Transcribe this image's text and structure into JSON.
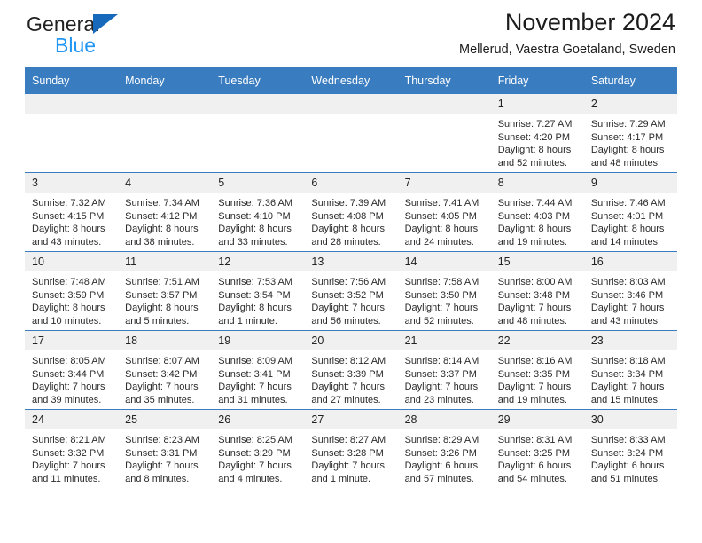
{
  "brand": {
    "name_top": "General",
    "name_bottom": "Blue",
    "accent_color": "#1669bb",
    "blue_color": "#2196f3",
    "triangle_icon": "brand-triangle-icon"
  },
  "header": {
    "title": "November 2024",
    "subtitle": "Mellerud, Vaestra Goetaland, Sweden"
  },
  "calendar": {
    "header_bg": "#3a7cc0",
    "daynum_bg": "#f0f0f0",
    "weekday_labels": [
      "Sunday",
      "Monday",
      "Tuesday",
      "Wednesday",
      "Thursday",
      "Friday",
      "Saturday"
    ],
    "weeks": [
      [
        {
          "day": "",
          "lines": []
        },
        {
          "day": "",
          "lines": []
        },
        {
          "day": "",
          "lines": []
        },
        {
          "day": "",
          "lines": []
        },
        {
          "day": "",
          "lines": []
        },
        {
          "day": "1",
          "lines": [
            "Sunrise: 7:27 AM",
            "Sunset: 4:20 PM",
            "Daylight: 8 hours",
            "and 52 minutes."
          ]
        },
        {
          "day": "2",
          "lines": [
            "Sunrise: 7:29 AM",
            "Sunset: 4:17 PM",
            "Daylight: 8 hours",
            "and 48 minutes."
          ]
        }
      ],
      [
        {
          "day": "3",
          "lines": [
            "Sunrise: 7:32 AM",
            "Sunset: 4:15 PM",
            "Daylight: 8 hours",
            "and 43 minutes."
          ]
        },
        {
          "day": "4",
          "lines": [
            "Sunrise: 7:34 AM",
            "Sunset: 4:12 PM",
            "Daylight: 8 hours",
            "and 38 minutes."
          ]
        },
        {
          "day": "5",
          "lines": [
            "Sunrise: 7:36 AM",
            "Sunset: 4:10 PM",
            "Daylight: 8 hours",
            "and 33 minutes."
          ]
        },
        {
          "day": "6",
          "lines": [
            "Sunrise: 7:39 AM",
            "Sunset: 4:08 PM",
            "Daylight: 8 hours",
            "and 28 minutes."
          ]
        },
        {
          "day": "7",
          "lines": [
            "Sunrise: 7:41 AM",
            "Sunset: 4:05 PM",
            "Daylight: 8 hours",
            "and 24 minutes."
          ]
        },
        {
          "day": "8",
          "lines": [
            "Sunrise: 7:44 AM",
            "Sunset: 4:03 PM",
            "Daylight: 8 hours",
            "and 19 minutes."
          ]
        },
        {
          "day": "9",
          "lines": [
            "Sunrise: 7:46 AM",
            "Sunset: 4:01 PM",
            "Daylight: 8 hours",
            "and 14 minutes."
          ]
        }
      ],
      [
        {
          "day": "10",
          "lines": [
            "Sunrise: 7:48 AM",
            "Sunset: 3:59 PM",
            "Daylight: 8 hours",
            "and 10 minutes."
          ]
        },
        {
          "day": "11",
          "lines": [
            "Sunrise: 7:51 AM",
            "Sunset: 3:57 PM",
            "Daylight: 8 hours",
            "and 5 minutes."
          ]
        },
        {
          "day": "12",
          "lines": [
            "Sunrise: 7:53 AM",
            "Sunset: 3:54 PM",
            "Daylight: 8 hours",
            "and 1 minute."
          ]
        },
        {
          "day": "13",
          "lines": [
            "Sunrise: 7:56 AM",
            "Sunset: 3:52 PM",
            "Daylight: 7 hours",
            "and 56 minutes."
          ]
        },
        {
          "day": "14",
          "lines": [
            "Sunrise: 7:58 AM",
            "Sunset: 3:50 PM",
            "Daylight: 7 hours",
            "and 52 minutes."
          ]
        },
        {
          "day": "15",
          "lines": [
            "Sunrise: 8:00 AM",
            "Sunset: 3:48 PM",
            "Daylight: 7 hours",
            "and 48 minutes."
          ]
        },
        {
          "day": "16",
          "lines": [
            "Sunrise: 8:03 AM",
            "Sunset: 3:46 PM",
            "Daylight: 7 hours",
            "and 43 minutes."
          ]
        }
      ],
      [
        {
          "day": "17",
          "lines": [
            "Sunrise: 8:05 AM",
            "Sunset: 3:44 PM",
            "Daylight: 7 hours",
            "and 39 minutes."
          ]
        },
        {
          "day": "18",
          "lines": [
            "Sunrise: 8:07 AM",
            "Sunset: 3:42 PM",
            "Daylight: 7 hours",
            "and 35 minutes."
          ]
        },
        {
          "day": "19",
          "lines": [
            "Sunrise: 8:09 AM",
            "Sunset: 3:41 PM",
            "Daylight: 7 hours",
            "and 31 minutes."
          ]
        },
        {
          "day": "20",
          "lines": [
            "Sunrise: 8:12 AM",
            "Sunset: 3:39 PM",
            "Daylight: 7 hours",
            "and 27 minutes."
          ]
        },
        {
          "day": "21",
          "lines": [
            "Sunrise: 8:14 AM",
            "Sunset: 3:37 PM",
            "Daylight: 7 hours",
            "and 23 minutes."
          ]
        },
        {
          "day": "22",
          "lines": [
            "Sunrise: 8:16 AM",
            "Sunset: 3:35 PM",
            "Daylight: 7 hours",
            "and 19 minutes."
          ]
        },
        {
          "day": "23",
          "lines": [
            "Sunrise: 8:18 AM",
            "Sunset: 3:34 PM",
            "Daylight: 7 hours",
            "and 15 minutes."
          ]
        }
      ],
      [
        {
          "day": "24",
          "lines": [
            "Sunrise: 8:21 AM",
            "Sunset: 3:32 PM",
            "Daylight: 7 hours",
            "and 11 minutes."
          ]
        },
        {
          "day": "25",
          "lines": [
            "Sunrise: 8:23 AM",
            "Sunset: 3:31 PM",
            "Daylight: 7 hours",
            "and 8 minutes."
          ]
        },
        {
          "day": "26",
          "lines": [
            "Sunrise: 8:25 AM",
            "Sunset: 3:29 PM",
            "Daylight: 7 hours",
            "and 4 minutes."
          ]
        },
        {
          "day": "27",
          "lines": [
            "Sunrise: 8:27 AM",
            "Sunset: 3:28 PM",
            "Daylight: 7 hours",
            "and 1 minute."
          ]
        },
        {
          "day": "28",
          "lines": [
            "Sunrise: 8:29 AM",
            "Sunset: 3:26 PM",
            "Daylight: 6 hours",
            "and 57 minutes."
          ]
        },
        {
          "day": "29",
          "lines": [
            "Sunrise: 8:31 AM",
            "Sunset: 3:25 PM",
            "Daylight: 6 hours",
            "and 54 minutes."
          ]
        },
        {
          "day": "30",
          "lines": [
            "Sunrise: 8:33 AM",
            "Sunset: 3:24 PM",
            "Daylight: 6 hours",
            "and 51 minutes."
          ]
        }
      ]
    ]
  }
}
